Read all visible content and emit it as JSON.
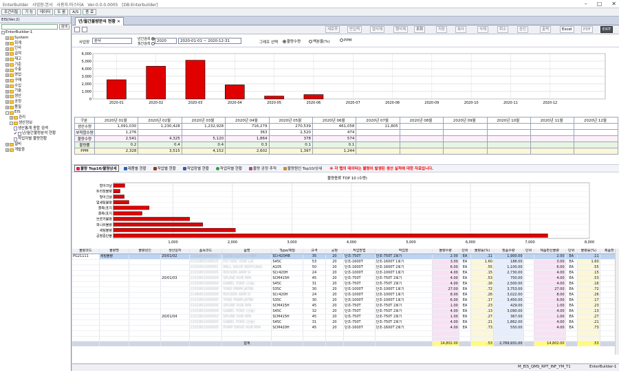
{
  "window": {
    "title_parts": [
      "EnterBuilder",
      "사업장:본사",
      "사용자:마스터A",
      "Ver-0.0.0.0005",
      "[DB:Enterbuilder]"
    ]
  },
  "menubar": {
    "items": [
      "조건리필",
      "기 능",
      "데이터",
      "도 움",
      "A/S",
      "종 료"
    ]
  },
  "sidebar": {
    "header": "EIS(Ver.2)",
    "search_value": "",
    "search_button": "검색",
    "root": "EnterBuilder-1",
    "items": [
      {
        "label": "System",
        "level": 1,
        "type": "folder"
      },
      {
        "label": "회계",
        "level": 1,
        "type": "folder"
      },
      {
        "label": "인사",
        "level": 1,
        "type": "folder"
      },
      {
        "label": "급여",
        "level": 1,
        "type": "folder"
      },
      {
        "label": "재고",
        "level": 1,
        "type": "folder"
      },
      {
        "label": "기준",
        "level": 1,
        "type": "folder"
      },
      {
        "label": "수출",
        "level": 1,
        "type": "folder"
      },
      {
        "label": "영업",
        "level": 1,
        "type": "folder"
      },
      {
        "label": "구매",
        "level": 1,
        "type": "folder"
      },
      {
        "label": "수입",
        "level": 1,
        "type": "folder"
      },
      {
        "label": "기술",
        "level": 1,
        "type": "folder"
      },
      {
        "label": "생산",
        "level": 1,
        "type": "folder"
      },
      {
        "label": "공정",
        "level": 1,
        "type": "folder"
      },
      {
        "label": "품질",
        "level": 1,
        "type": "folder"
      },
      {
        "label": "EIS",
        "level": 1,
        "type": "folder-open"
      },
      {
        "label": "관리",
        "level": 2,
        "type": "folder"
      },
      {
        "label": "생산정보",
        "level": 2,
        "type": "folder-open"
      },
      {
        "label": "생산통계 종합 검색",
        "level": 3,
        "type": "doc"
      },
      {
        "label": "년/월간불량분석 현황",
        "level": 3,
        "type": "doc-checked"
      },
      {
        "label": "작업자별 불량현황",
        "level": 3,
        "type": "doc"
      },
      {
        "label": "설비",
        "level": 1,
        "type": "folder"
      },
      {
        "label": "개발중",
        "level": 1,
        "type": "folder"
      }
    ]
  },
  "tab": {
    "label": "년/월간불량분석 현황"
  },
  "toolbar": {
    "buttons": [
      {
        "label": "새로추",
        "enabled": false
      },
      {
        "label": "반입력",
        "enabled": false
      },
      {
        "label": "열삭제",
        "enabled": false
      },
      {
        "label": "행삭제",
        "enabled": false
      },
      {
        "label": "조회",
        "enabled": true
      },
      {
        "label": "저장",
        "enabled": false
      },
      {
        "label": "복사",
        "enabled": false
      },
      {
        "label": "삭제",
        "enabled": false
      },
      {
        "label": "취소",
        "enabled": false
      },
      {
        "label": "승인",
        "enabled": false
      },
      {
        "label": "출력",
        "enabled": false
      },
      {
        "label": "Excel",
        "enabled": true
      },
      {
        "label": "PDF",
        "enabled": false
      },
      {
        "label": "EXIT",
        "enabled": true
      }
    ]
  },
  "filter": {
    "site_label": "사업장",
    "site_value": "본사",
    "period_label_1": "년간검색",
    "period_label_2": "월간검색",
    "year_value": "2020",
    "range_value": "2020-01-01 ~ 2020-12-31",
    "graph_label": "그래프 선택",
    "graph_options": [
      "불량수량",
      "백분율(%)",
      "PPM"
    ],
    "graph_selected": "불량수량"
  },
  "colors": {
    "bar": "#e00000",
    "accent_pink": "#f7e2f3",
    "accent_yellow": "#fbf7d8"
  },
  "chart_data": [
    {
      "type": "bar",
      "title": "",
      "categories": [
        "2020-01",
        "2020-02",
        "2020-03",
        "2020-04",
        "2020-05",
        "2020-06",
        "2020-07",
        "2020-08",
        "2020-09",
        "2020-10",
        "2020-11",
        "2020-12"
      ],
      "values": [
        2541,
        4325,
        5120,
        1864,
        378,
        574,
        0,
        0,
        0,
        0,
        0,
        0
      ],
      "ylim": [
        0,
        6000
      ],
      "yticks": [
        "0",
        "1,000",
        "2,000",
        "3,000",
        "4,000",
        "5,000",
        "6,000"
      ],
      "grid": true
    },
    {
      "type": "bar",
      "orientation": "horizontal",
      "title": "불량종류 TOP 10 (수량)",
      "categories": [
        "형아크날",
        "트리징불량",
        "형아크날",
        "업세팅불량",
        "결육(포지",
        "결육(포지",
        "브로커불량",
        "피니쉬불량",
        "세팅불량",
        "공정중단불"
      ],
      "values": [
        190,
        110,
        180,
        260,
        600,
        480,
        1280,
        1500,
        2050,
        7300
      ],
      "xlim": [
        0,
        8000
      ],
      "xticks": [
        "1,000",
        "2,000",
        "3,000",
        "4,000",
        "5,000",
        "6,000",
        "7,000",
        "8,000"
      ],
      "grid": true
    }
  ],
  "summary_table": {
    "headers": [
      "구분",
      "2020년 01월",
      "2020년 02월",
      "2020년 03월",
      "2020년 04월",
      "2020년 05월",
      "2020년 06월",
      "2020년 07월",
      "2020년 08월",
      "2020년 09월",
      "2020년 10월",
      "2020년 11월",
      "2020년 12월"
    ],
    "rows": [
      {
        "label": "생산수량",
        "values": [
          "1,091,030",
          "1,230,428",
          "1,232,928",
          "716,279",
          "270,539",
          "461,058",
          "11,805",
          "",
          "",
          "",
          "",
          ""
        ]
      },
      {
        "label": "부적합수량",
        "values": [
          "1,276",
          "",
          "",
          "363",
          "2,520",
          "474",
          "",
          "",
          "",
          "",
          "",
          ""
        ]
      },
      {
        "label": "불량수량",
        "values": [
          "2,541",
          "4,325",
          "5,120",
          "1,864",
          "378",
          "574",
          "",
          "",
          "",
          "",
          "",
          ""
        ]
      },
      {
        "label": "불량률",
        "values": [
          "0.2",
          "0.4",
          "0.4",
          "0.3",
          "0.1",
          "0.1",
          "",
          "",
          "",
          "",
          "",
          ""
        ]
      },
      {
        "label": "PPM",
        "values": [
          "2,328",
          "3,515",
          "4,152",
          "2,602",
          "1,397",
          "1,244",
          "",
          "",
          "",
          "",
          "",
          ""
        ]
      }
    ]
  },
  "sub_tabs": {
    "items": [
      "불량 Top10/불량상세",
      "제품별 현황",
      "작업별 현황",
      "작업장별 현황",
      "작업자별 현황",
      "불량 공정 추적",
      "불량원인 Top10/상세"
    ],
    "notice": "※ 각 탭의 데이터는 불량이 발생된 생산 실적에 대한 자료입니다."
  },
  "detail_table": {
    "headers": [
      "불량코드",
      "불량명",
      "불량원인",
      "생산일자",
      "품목코드",
      "품명",
      "Type/재질",
      "규격",
      "공정",
      "작업방법",
      "작업장",
      "불량수량",
      "단위",
      "불량률(%)",
      "정품수량",
      "단위",
      "제품환산불량",
      "단위",
      "불량률(%)",
      "제품환"
    ],
    "rows": [
      [
        "PG21111",
        "세팅불량",
        "",
        "20/01/02",
        "2101801000001",
        "GEAR CLUTCH HNM",
        "SCr420HB",
        "35",
        "20",
        "단조-750T",
        "단조-750T 2호기",
        "2.00",
        "EA",
        ".11",
        "1,900.00",
        "",
        "2.00",
        "EA",
        ".11",
        ""
      ],
      [
        "",
        "",
        "",
        "",
        "2101805100025",
        "FLY DISC 02W L/A",
        "S45C",
        "53",
        "20",
        "단조-1600T",
        "단조-1600T 1호기",
        "3.00",
        "EA",
        "1.60",
        "188.00",
        "",
        "3.00",
        "EA",
        "1.60",
        ""
      ],
      [
        "",
        "",
        "",
        "",
        "2102001000001",
        "BALL VALVE BODY(AIA)",
        "A105",
        "50",
        "20",
        "단조-1600T",
        "단조-1600T 2호기",
        "6.00",
        "EA",
        ".55",
        "1,100.00",
        "",
        "6.00",
        "EA",
        ".55",
        ""
      ],
      [
        "",
        "",
        "",
        "",
        "2101801000005",
        "ROCKER ARM SI",
        "SCr420H",
        "24",
        "20",
        "단조-1000T",
        "단조-1000T 1호기",
        "4.00",
        "EA",
        ".15",
        "2,730.00",
        "",
        "4.00",
        "EA",
        ".15",
        ""
      ],
      [
        "",
        "",
        "",
        "20/01/03",
        "2101801000004",
        "SPLINE HUB RPA",
        "SCM415H",
        "45",
        "20",
        "단조-750T",
        "단조-750T 2호기",
        "4.00",
        "EA",
        ".53",
        "750.00",
        "",
        "4.00",
        "EA",
        ".53",
        ""
      ],
      [
        "",
        "",
        "",
        "",
        "2101801000004",
        "GABEL YOKE (큰놈)",
        "S45C",
        "31",
        "20",
        "단조-750T",
        "단조-750T 2호기",
        "4.00",
        "EA",
        ".16",
        "2,500.00",
        "",
        "4.00",
        "EA",
        ".16",
        ""
      ],
      [
        "",
        "",
        "",
        "",
        "2101801000000",
        "YOKE PR8M JAT86",
        "S35C",
        "30",
        "20",
        "단조-1000T",
        "단조-1000T 1호기",
        "27.00",
        "EA",
        ".72",
        "3,753.00",
        "",
        "27.00",
        "EA",
        ".72",
        ""
      ],
      [
        "",
        "",
        "",
        "",
        "2148401000000",
        "ROCKER ARM SI",
        "SCr420H",
        "24",
        "20",
        "단조-1000T",
        "단조-1000T 1호기",
        "8.00",
        "EA",
        ".26",
        "3,022.00",
        "",
        "8.00",
        "EA",
        ".26",
        ""
      ],
      [
        "",
        "",
        "",
        "",
        "2101801000005",
        "YOKE PR8M JAT86",
        "S35C",
        "30",
        "20",
        "단조-1000T",
        "단조-1000T 1호기",
        "6.00",
        "EA",
        ".17",
        "3,450.00",
        "",
        "6.00",
        "EA",
        ".17",
        ""
      ],
      [
        "",
        "",
        "",
        "",
        "2101801000000",
        "SPLINE HUB RPA",
        "SCM415H",
        "45",
        "20",
        "단조-750T",
        "단조-750T 2호기",
        "1.00",
        "EA",
        ".23",
        "429.00",
        "",
        "1.00",
        "EA",
        ".23",
        ""
      ],
      [
        "",
        "",
        "",
        "",
        "2101801000004",
        "GABEL YOKE (큰놈)",
        "S45C",
        "32",
        "20",
        "단조-750T",
        "단조-750T 2호기",
        "4.00",
        "EA",
        ".13",
        "3,090.00",
        "",
        "4.00",
        "EA",
        ".13",
        ""
      ],
      [
        "",
        "",
        "",
        "20/01/04",
        "2101801000002",
        "SPLINE HUB RPA",
        "SCM415H",
        "45",
        "20",
        "단조-750T",
        "단조-750T 2호기",
        "1.00",
        "EA",
        ".27",
        "367.00",
        "",
        "1.00",
        "EA",
        ".27",
        ""
      ],
      [
        "",
        "",
        "",
        "",
        "2101801000005",
        "GABEL YOKE (큰놈)",
        "S45C",
        "31",
        "20",
        "단조-750T",
        "단조-750T 2호기",
        "4.00",
        "EA",
        ".21",
        "1,862.00",
        "",
        "4.00",
        "EA",
        ".21",
        ""
      ],
      [
        "",
        "",
        "",
        "",
        "2101801000005",
        "PUMP DRIVE HUB RPA",
        "SCM420H",
        "45",
        "20",
        "단조-1600T",
        "단조-1600T 2호기",
        "4.00",
        "EA",
        ".73",
        "550.00",
        "",
        "4.00",
        "EA",
        ".73",
        ""
      ]
    ],
    "total": {
      "label": "합계",
      "defect_qty": "14,802.00",
      "defect_rate": ".53",
      "good_qty": "2,769,931.00",
      "conv_qty": "14,802.00",
      "conv_rate": ".53"
    }
  },
  "statusbar": {
    "form_id": "M_EIS_QMS_RPT_INF_YM_T1",
    "user": "EnterBuilder-1"
  }
}
